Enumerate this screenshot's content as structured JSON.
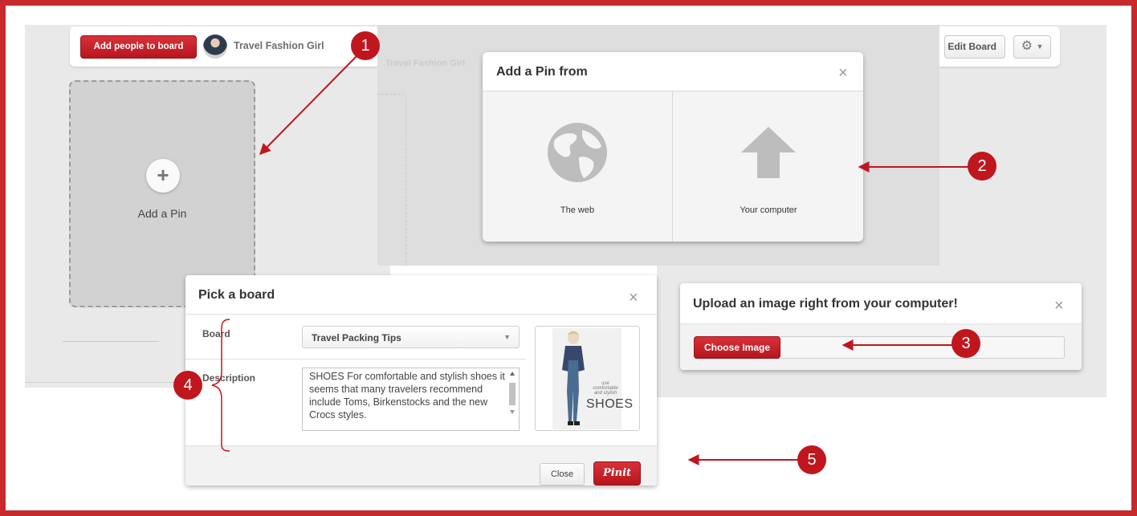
{
  "colors": {
    "accent_red": "#c8292c",
    "pinterest_red": "#cb2027",
    "panel_gray": "#e9e9e9"
  },
  "board_header": {
    "add_people_label": "Add people to board",
    "owner_name": "Travel Fashion Girl",
    "edit_board_label": "Edit Board",
    "settings_icon": "gear-icon"
  },
  "add_pin_card": {
    "label": "Add a Pin",
    "icon": "plus-icon"
  },
  "background_ghost": {
    "owner_name": "Travel Fashion Girl"
  },
  "add_pin_modal": {
    "title": "Add a Pin from",
    "close_label": "×",
    "options": [
      {
        "label": "The web",
        "icon": "globe-icon"
      },
      {
        "label": "Your computer",
        "icon": "upload-arrow-icon"
      }
    ]
  },
  "upload_modal": {
    "title": "Upload an image right from your computer!",
    "close_label": "×",
    "choose_label": "Choose Image"
  },
  "pick_board_modal": {
    "title": "Pick a board",
    "close_label": "×",
    "board_label": "Board",
    "board_value": "Travel Packing Tips",
    "description_label": "Description",
    "description_value": "SHOES For comfortable and stylish shoes it seems that many travelers recommend include Toms, Birkenstocks and the new Crocs styles.",
    "thumbnail": {
      "small_text": "use comfortable and stylish",
      "big_text": "SHOES"
    },
    "close_button": "Close",
    "pinit_button": "Pinit"
  },
  "steps": [
    "1",
    "2",
    "3",
    "4",
    "5"
  ]
}
